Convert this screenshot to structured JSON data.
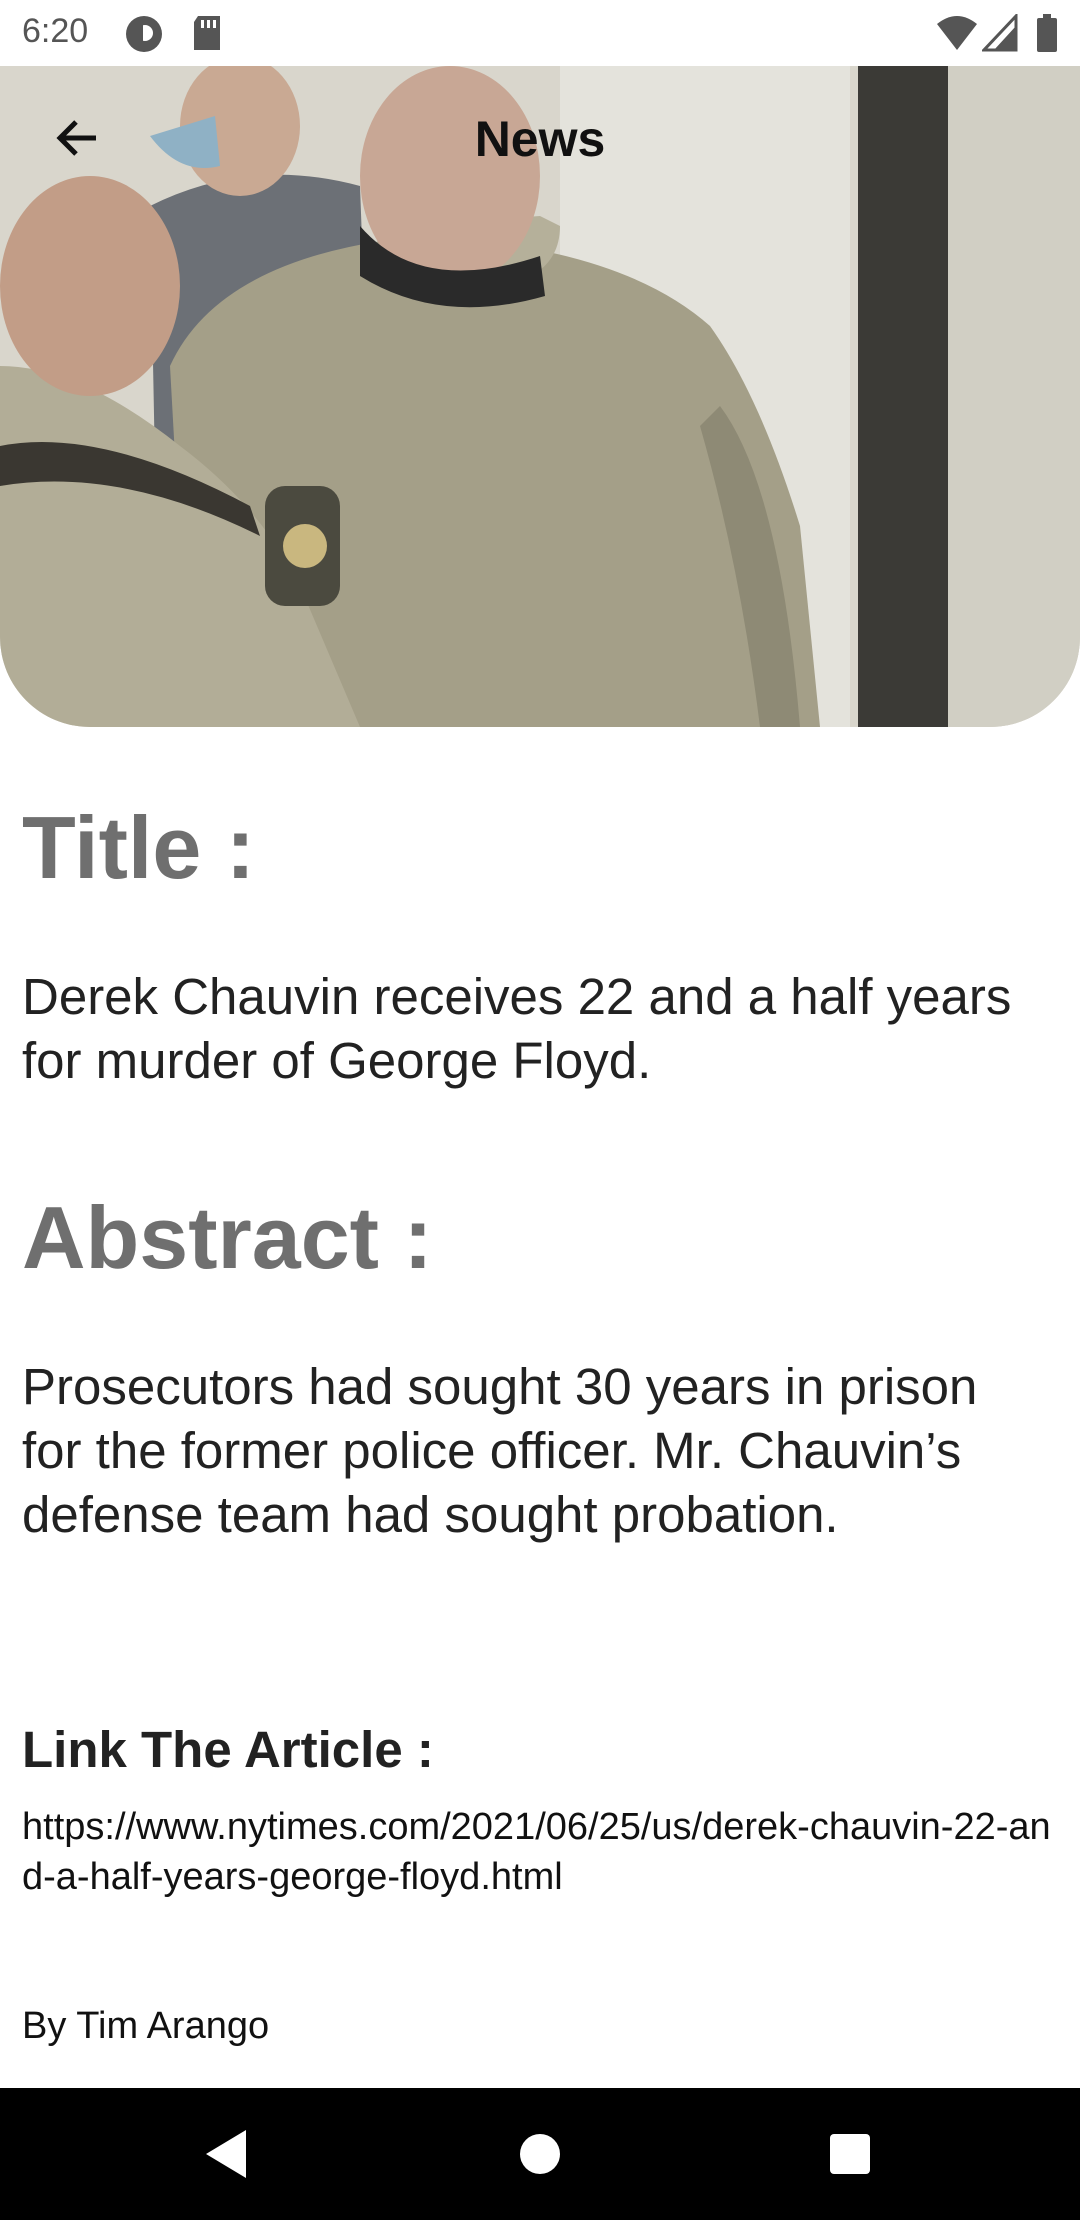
{
  "status_bar": {
    "time": "6:20",
    "icons": [
      "pocket-casts-icon",
      "sd-card-icon",
      "wifi-icon",
      "signal-icon",
      "battery-icon"
    ]
  },
  "app_bar": {
    "title": "News",
    "back_icon": "arrow-left-icon"
  },
  "article": {
    "title_heading": "Title :",
    "title": "Derek Chauvin receives 22 and a half years for murder of George Floyd.",
    "abstract_heading": "Abstract :",
    "abstract": "Prosecutors had sought 30 years in prison for the former police officer. Mr. Chauvin’s defense team had sought probation.",
    "link_heading": "Link The Article :",
    "link": "https://www.nytimes.com/2021/06/25/us/derek-chauvin-22-and-a-half-years-george-floyd.html",
    "byline": "By Tim Arango"
  },
  "nav_bar": {
    "back_icon": "nav-back-triangle-icon",
    "home_icon": "nav-home-circle-icon",
    "recents_icon": "nav-recents-square-icon"
  },
  "colors": {
    "heading_gray": "#6f6f6f",
    "body_text": "#222222",
    "nav_bar": "#000000"
  }
}
